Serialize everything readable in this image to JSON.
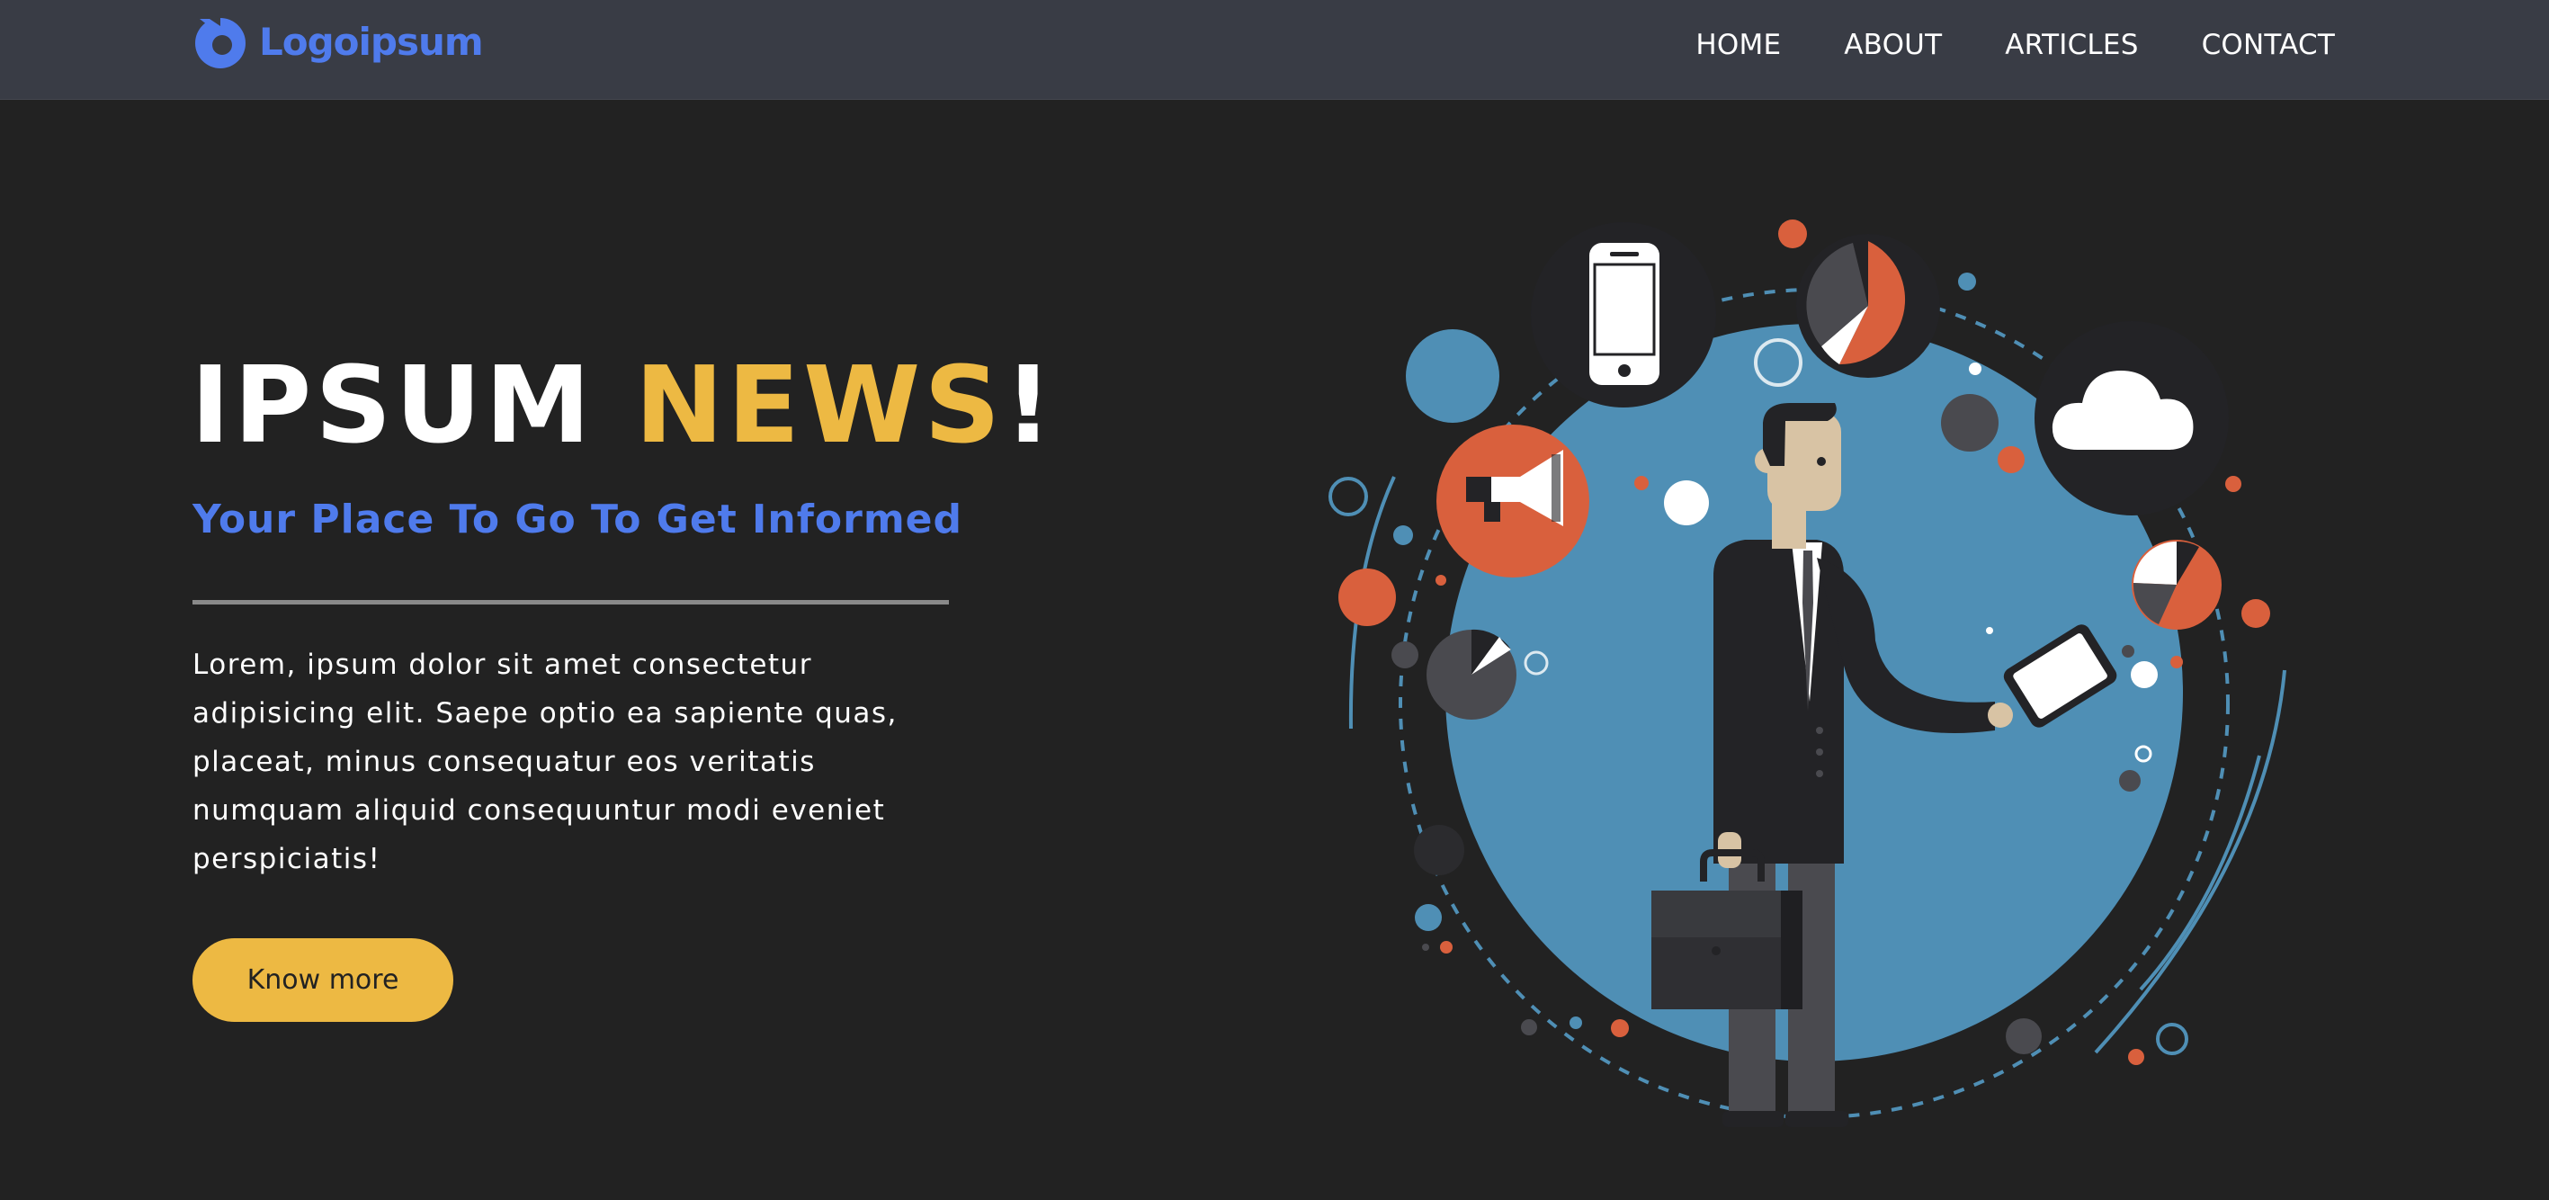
{
  "brand": {
    "name": "Logoipsum",
    "logo_icon": "logoipsum-mark-icon",
    "accent_color": "#4f7bec"
  },
  "nav": {
    "items": [
      {
        "label": "HOME"
      },
      {
        "label": "ABOUT"
      },
      {
        "label": "ARTICLES"
      },
      {
        "label": "CONTACT"
      }
    ]
  },
  "hero": {
    "title_part1": "IPSUM ",
    "title_part2": "NEWS",
    "title_part3": "!",
    "subtitle": "Your Place To Go To Get Informed",
    "body": "Lorem, ipsum dolor sit amet consectetur adipisicing elit. Saepe optio ea sapiente quas, placeat, minus consequatur eos veritatis numquam aliquid consequuntur modi eveniet perspiciatis!",
    "button_label": "Know more",
    "accent_color": "#edb943"
  },
  "illustration": {
    "subject": "businessman-with-icons",
    "icons": [
      "smartphone-icon",
      "pie-chart-icon",
      "cloud-icon",
      "megaphone-icon",
      "tablet-icon",
      "briefcase-icon"
    ]
  }
}
